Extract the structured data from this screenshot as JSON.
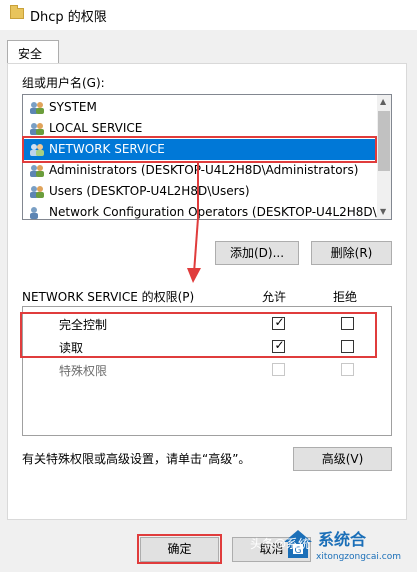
{
  "window": {
    "title": "Dhcp 的权限"
  },
  "tabs": [
    {
      "label": "安全"
    }
  ],
  "group_section": {
    "label": "组或用户名(G):",
    "items": [
      {
        "label": "SYSTEM"
      },
      {
        "label": "LOCAL SERVICE"
      },
      {
        "label": "NETWORK SERVICE",
        "selected": true
      },
      {
        "label": "Administrators (DESKTOP-U4L2H8D\\Administrators)"
      },
      {
        "label": "Users (DESKTOP-U4L2H8D\\Users)"
      },
      {
        "label": "Network Configuration Operators (DESKTOP-U4L2H8D\\..."
      }
    ]
  },
  "buttons": {
    "add": "添加(D)...",
    "remove": "删除(R)",
    "advanced": "高级(V)",
    "ok": "确定",
    "cancel": "取消"
  },
  "permissions": {
    "header": "NETWORK SERVICE 的权限(P)",
    "allow_header": "允许",
    "deny_header": "拒绝",
    "rows": [
      {
        "name": "完全控制",
        "allow": true,
        "deny": false,
        "enabled": true
      },
      {
        "name": "读取",
        "allow": true,
        "deny": false,
        "enabled": true
      },
      {
        "name": "特殊权限",
        "allow": false,
        "deny": false,
        "enabled": false
      }
    ]
  },
  "advanced_note": "有关特殊权限或高级设置，请单击“高级”。",
  "watermark": {
    "brand": "系统合",
    "url": "xitongzongcai.com",
    "overlay": "头条@系统"
  },
  "colors": {
    "selection": "#0078d7",
    "highlight": "#e03c3c",
    "brand": "#1b6fb8"
  }
}
